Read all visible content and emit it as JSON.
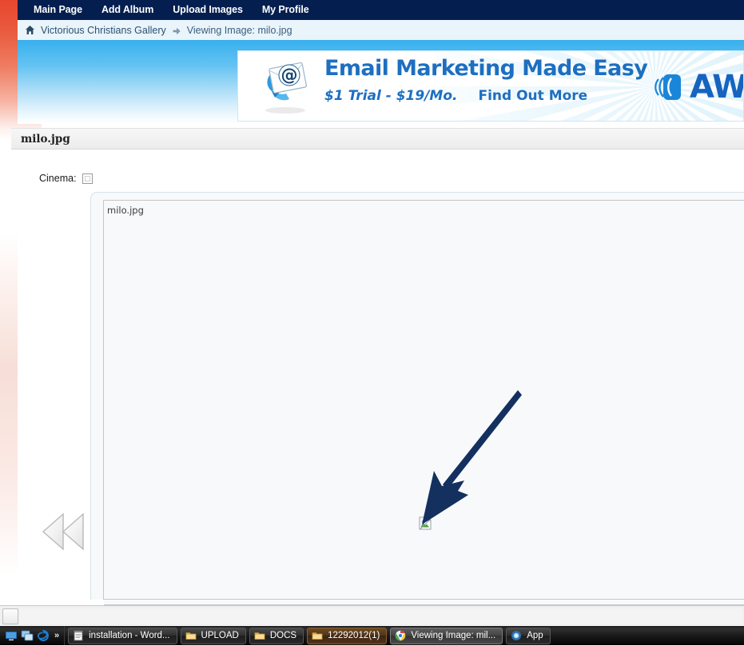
{
  "nav": {
    "items": [
      {
        "label": "Main Page",
        "name": "nav-main-page"
      },
      {
        "label": "Add Album",
        "name": "nav-add-album"
      },
      {
        "label": "Upload Images",
        "name": "nav-upload-images"
      },
      {
        "label": "My Profile",
        "name": "nav-my-profile"
      }
    ]
  },
  "breadcrumb": {
    "home_icon": "home-icon",
    "root": "Victorious Christians Gallery",
    "separator_icon": "arrow-right-icon",
    "current": "Viewing Image: milo.jpg"
  },
  "ad": {
    "headline": "Email Marketing Made Easy",
    "price": "$1 Trial - $19/Mo.",
    "cta": "Find Out More",
    "brand": "AWe",
    "envelope_icon": "email-envelope-icon",
    "logo_icon": "aweber-logo-icon"
  },
  "page": {
    "title": "milo.jpg"
  },
  "options": {
    "cinema_label": "Cinema:",
    "cinema_checked": false
  },
  "viewer": {
    "alt_text": "milo.jpg",
    "broken_image_icon": "broken-image-icon",
    "prev_icon": "rewind-previous-icon",
    "annotation_icon": "annotation-arrow-icon"
  },
  "scrollbar": {
    "left_button_icon": "scroll-left-icon"
  },
  "taskbar": {
    "quick_launch": [
      {
        "icon": "show-desktop-icon",
        "name": "ql-show-desktop"
      },
      {
        "icon": "switch-window-icon",
        "name": "ql-switch-window"
      },
      {
        "icon": "internet-explorer-icon",
        "name": "ql-internet-explorer"
      }
    ],
    "overflow_label": "»",
    "buttons": [
      {
        "label": "installation - Word...",
        "icon": "notepad-icon",
        "style": "normal",
        "name": "task-installation-word"
      },
      {
        "label": "UPLOAD",
        "icon": "folder-icon",
        "style": "normal",
        "name": "task-upload"
      },
      {
        "label": "DOCS",
        "icon": "folder-icon",
        "style": "normal",
        "name": "task-docs"
      },
      {
        "label": "12292012(1)",
        "icon": "folder-icon",
        "style": "warm",
        "name": "task-12292012"
      },
      {
        "label": "Viewing Image: mil...",
        "icon": "chrome-icon",
        "style": "active",
        "name": "task-viewing-image"
      },
      {
        "label": "App",
        "icon": "app-icon",
        "style": "normal",
        "name": "task-app"
      }
    ]
  },
  "colors": {
    "nav_bg": "#041e4f",
    "breadcrumb_bg": "#e9f4fb",
    "banner_blue": "#38b0ee",
    "accent_red": "#e8472e",
    "annotation": "#13305f",
    "ad_blue": "#1d6fc0"
  }
}
